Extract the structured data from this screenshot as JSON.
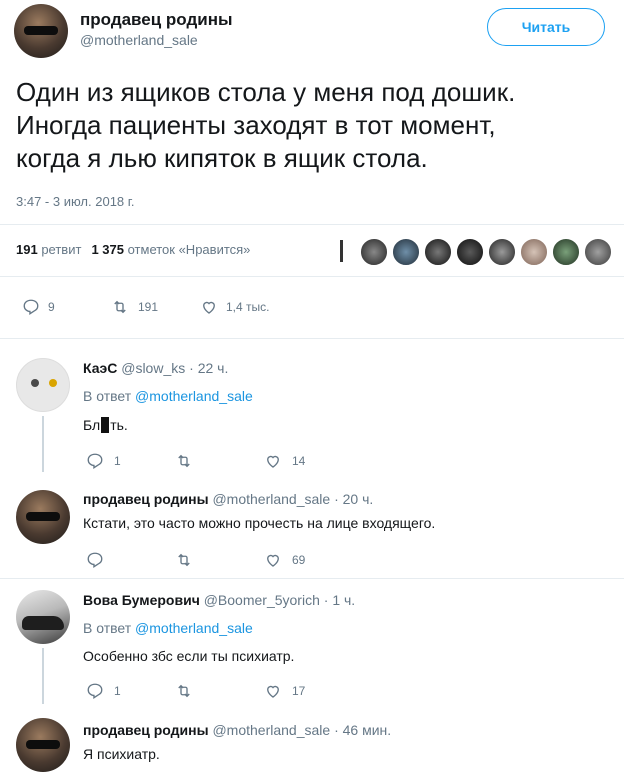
{
  "tweet": {
    "author_name": "продавец родины",
    "author_handle": "@motherland_sale",
    "follow_label": "Читать",
    "text_lines": [
      "Один из ящиков стола у меня под дошик.",
      "Иногда пациенты заходят в тот момент,",
      "когда я лью кипяток в ящик стола."
    ],
    "timestamp": "3:47 - 3 июл. 2018 г.",
    "retweets_count": "191",
    "retweets_label": "ретвит",
    "likes_count": "1 375",
    "likes_label": "отметок «Нравится»",
    "actions": {
      "replies": "9",
      "retweets": "191",
      "likes": "1,4 тыс."
    }
  },
  "replies": [
    {
      "name": "КаэС",
      "handle": "@slow_ks",
      "time": "· 22 ч.",
      "reply_to_prefix": "В ответ",
      "reply_to": "@motherland_sale",
      "text_before": "Бл",
      "text_after": "ть.",
      "replies": "1",
      "retweets": "",
      "likes": "14"
    },
    {
      "name": "продавец родины",
      "handle": "@motherland_sale",
      "time": "· 20 ч.",
      "text": "Кстати, это часто можно прочесть на лице входящего.",
      "replies": "",
      "retweets": "",
      "likes": "69"
    },
    {
      "name": "Вова Бумерович",
      "handle": "@Boomer_5yorich",
      "time": "· 1 ч.",
      "reply_to_prefix": "В ответ",
      "reply_to": "@motherland_sale",
      "text": "Особенно збс если ты психиатр.",
      "replies": "1",
      "retweets": "",
      "likes": "17"
    },
    {
      "name": "продавец родины",
      "handle": "@motherland_sale",
      "time": "· 46 мин.",
      "text": "Я психиатр."
    }
  ],
  "icons": {
    "reply": "reply-icon",
    "retweet": "retweet-icon",
    "like": "heart-icon"
  },
  "colors": {
    "accent": "#1da1f2",
    "link": "#1b95e0",
    "muted": "#657786",
    "like_red": "#e0245e"
  }
}
